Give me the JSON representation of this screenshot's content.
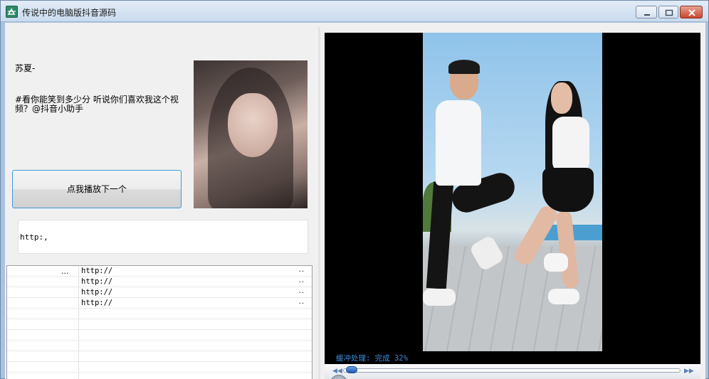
{
  "window": {
    "title": "传说中的电脑版抖音源码"
  },
  "video_info": {
    "author": "苏夏-",
    "description": "#看你能笑到多少分 听说你们喜欢我这个视频？@抖音小助手",
    "next_button_label": "点我播放下一个",
    "url_value": "http:,"
  },
  "list": {
    "rows": [
      {
        "name": "",
        "url": "http://",
        "ellipsis": ".."
      },
      {
        "name": "",
        "url": "http://",
        "ellipsis": ".."
      },
      {
        "name": "",
        "url": "http://",
        "ellipsis": ".."
      },
      {
        "name": "",
        "url": "http://",
        "ellipsis": ".."
      }
    ],
    "name_ellipsis": "..."
  },
  "player": {
    "status_text": "缓冲处理: 完成 32%",
    "buffer_progress": 0.32,
    "seek_position": 0.0
  },
  "colors": {
    "accent": "#3c9ad6",
    "status_text": "#3a8cde",
    "close_button": "#c8452b"
  }
}
